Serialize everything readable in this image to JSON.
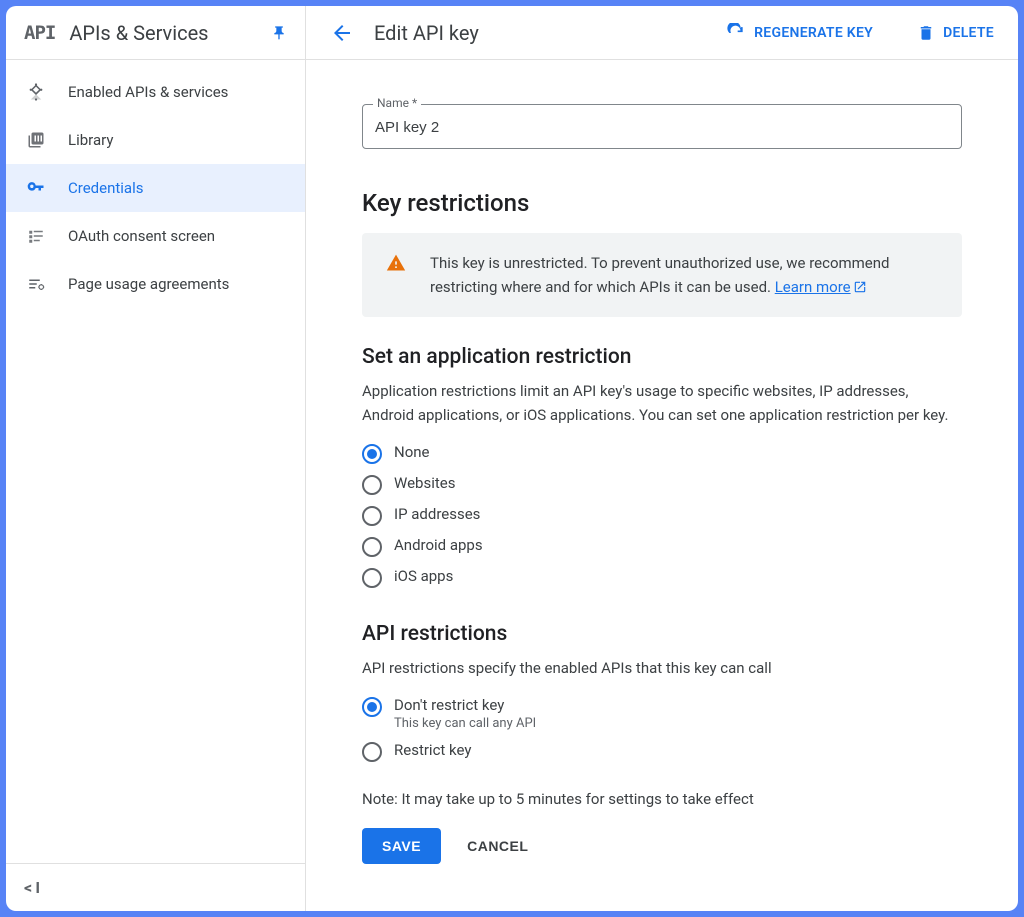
{
  "sidebar": {
    "title": "APIs & Services",
    "items": [
      {
        "label": "Enabled APIs & services"
      },
      {
        "label": "Library"
      },
      {
        "label": "Credentials"
      },
      {
        "label": "OAuth consent screen"
      },
      {
        "label": "Page usage agreements"
      }
    ]
  },
  "header": {
    "title": "Edit API key",
    "regenerate": "REGENERATE KEY",
    "delete": "DELETE"
  },
  "form": {
    "name_label": "Name *",
    "name_value": "API key 2"
  },
  "key_restrictions": {
    "heading": "Key restrictions",
    "alert_text": "This key is unrestricted. To prevent unauthorized use, we recommend restricting where and for which APIs it can be used. ",
    "learn_more": "Learn more"
  },
  "app_restriction": {
    "heading": "Set an application restriction",
    "desc": "Application restrictions limit an API key's usage to specific websites, IP addresses, Android applications, or iOS applications. You can set one application restriction per key.",
    "options": [
      {
        "label": "None"
      },
      {
        "label": "Websites"
      },
      {
        "label": "IP addresses"
      },
      {
        "label": "Android apps"
      },
      {
        "label": "iOS apps"
      }
    ]
  },
  "api_restrictions": {
    "heading": "API restrictions",
    "desc": "API restrictions specify the enabled APIs that this key can call",
    "options": [
      {
        "label": "Don't restrict key",
        "sub": "This key can call any API"
      },
      {
        "label": "Restrict key"
      }
    ]
  },
  "note": "Note: It may take up to 5 minutes for settings to take effect",
  "buttons": {
    "save": "SAVE",
    "cancel": "CANCEL"
  }
}
